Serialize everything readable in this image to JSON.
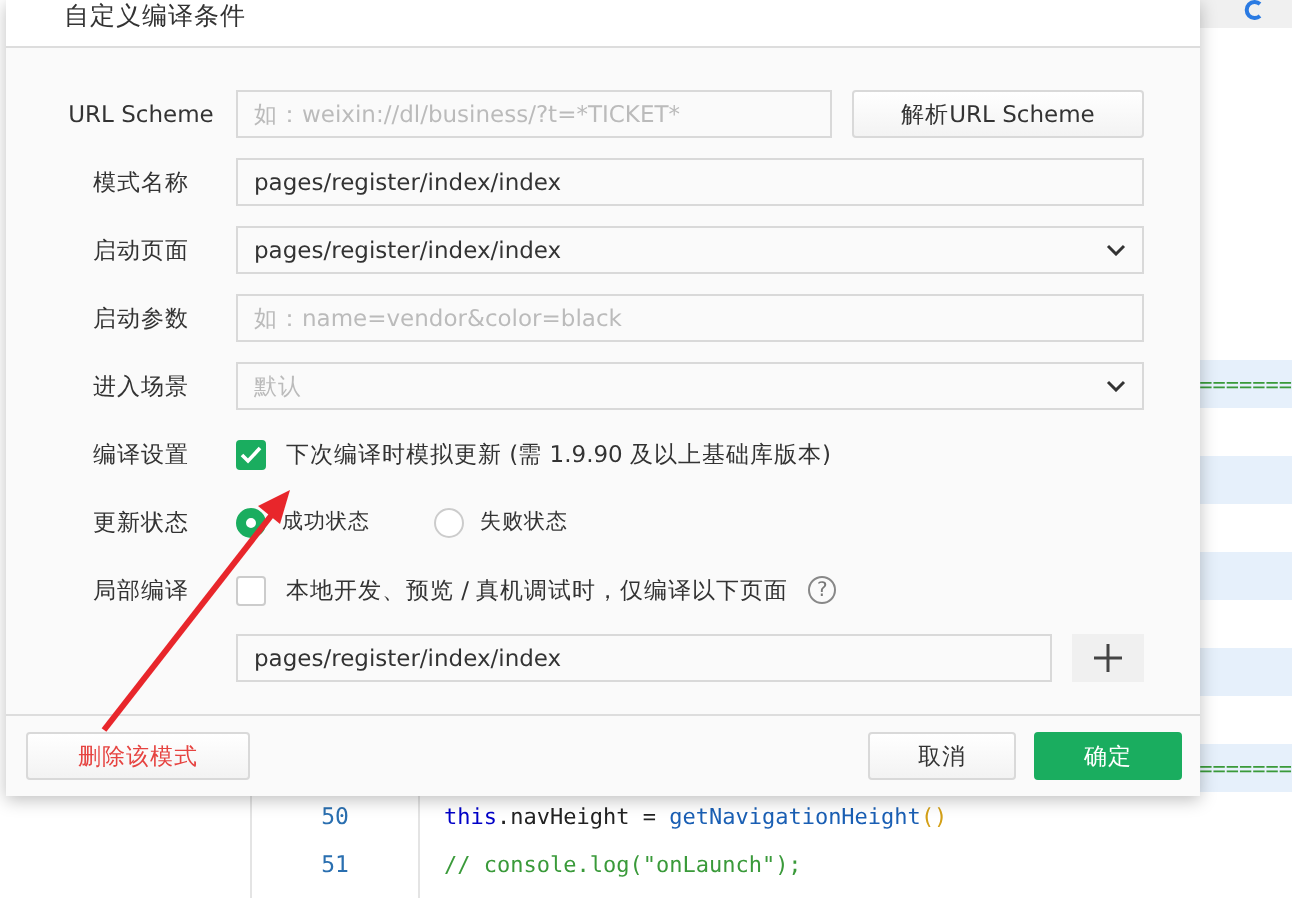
{
  "editor": {
    "lines": [
      {
        "kind": "separator",
        "highlighted": true,
        "code": "======="
      },
      {
        "kind": "blank",
        "highlighted": false
      },
      {
        "kind": "blank",
        "highlighted": true
      },
      {
        "kind": "blank",
        "highlighted": false
      },
      {
        "kind": "blank",
        "highlighted": true
      },
      {
        "kind": "blank",
        "highlighted": false
      },
      {
        "kind": "blank",
        "highlighted": true
      },
      {
        "kind": "blank",
        "highlighted": false
      },
      {
        "kind": "separator",
        "highlighted": true,
        "code": "======="
      },
      {
        "kind": "code",
        "highlighted": false,
        "number": "50",
        "tokens": [
          {
            "kind": "keyword",
            "text": "this"
          },
          {
            "kind": "plain",
            "text": ".navHeight = "
          },
          {
            "kind": "function",
            "text": "getNavigationHeight"
          },
          {
            "kind": "paren",
            "text": "()"
          }
        ]
      },
      {
        "kind": "code",
        "highlighted": false,
        "number": "51",
        "tokens": [
          {
            "kind": "comment",
            "text": "// console.log(\"onLaunch\");"
          }
        ]
      }
    ]
  },
  "dialog": {
    "title": "自定义编译条件",
    "fields": [
      {
        "label": "URL Scheme",
        "kind": "input",
        "placeholder": "如：weixin://dl/business/?t=*TICKET*",
        "button": "解析URL Scheme"
      },
      {
        "label": "模式名称",
        "kind": "input",
        "value": "pages/register/index/index"
      },
      {
        "label": "启动页面",
        "kind": "select",
        "value": "pages/register/index/index"
      },
      {
        "label": "启动参数",
        "kind": "input",
        "placeholder": "如：name=vendor&color=black"
      },
      {
        "label": "进入场景",
        "kind": "select",
        "placeholder": "默认"
      }
    ],
    "compile_setting": {
      "label": "编译设置",
      "checked": true,
      "text": "下次编译时模拟更新 (需 1.9.90 及以上基础库版本)"
    },
    "update_state": {
      "label": "更新状态",
      "options": [
        {
          "label": "成功状态",
          "selected": true
        },
        {
          "label": "失败状态",
          "selected": false
        }
      ]
    },
    "partial_compile": {
      "label": "局部编译",
      "checked": false,
      "text": "本地开发、预览 / 真机调试时，仅编译以下页面",
      "help": "?",
      "page_field": {
        "value": "pages/register/index/index"
      }
    },
    "footer": {
      "delete_button": "删除该模式",
      "cancel_button": "取消",
      "confirm_button": "确定"
    }
  }
}
